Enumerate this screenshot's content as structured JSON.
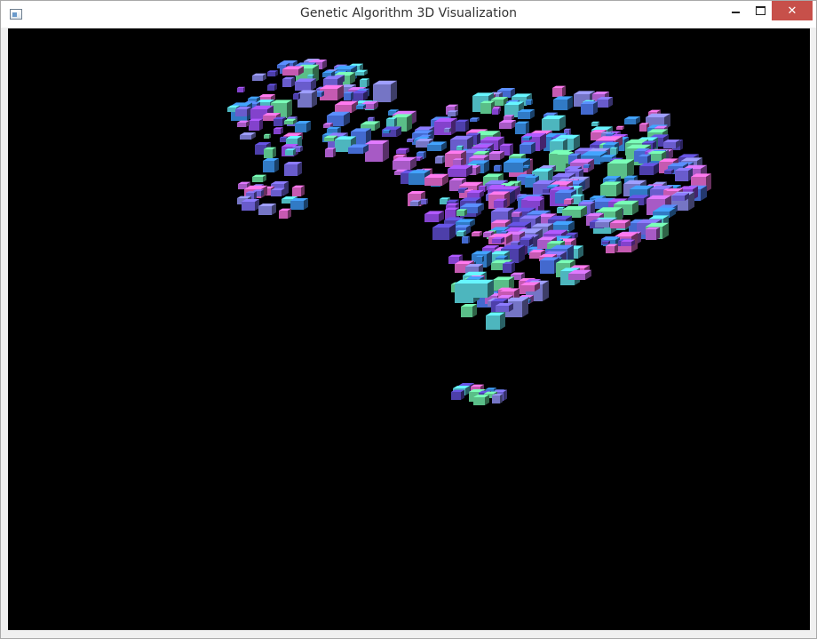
{
  "window": {
    "title": "Genetic Algorithm 3D Visualization",
    "icons": {
      "app": "app-window-icon",
      "minimize": "minimize-icon",
      "maximize": "maximize-icon",
      "close": "close-icon"
    },
    "close_glyph": "✕"
  },
  "viewport": {
    "background": "#000000",
    "palette": [
      "#7b6cf0",
      "#4f7cf2",
      "#9a4ef0",
      "#3a8fe8",
      "#5ad6e0",
      "#6ae0a0",
      "#c46ae8",
      "#e86ad0",
      "#8a8ae8",
      "#5a4ac8"
    ]
  }
}
